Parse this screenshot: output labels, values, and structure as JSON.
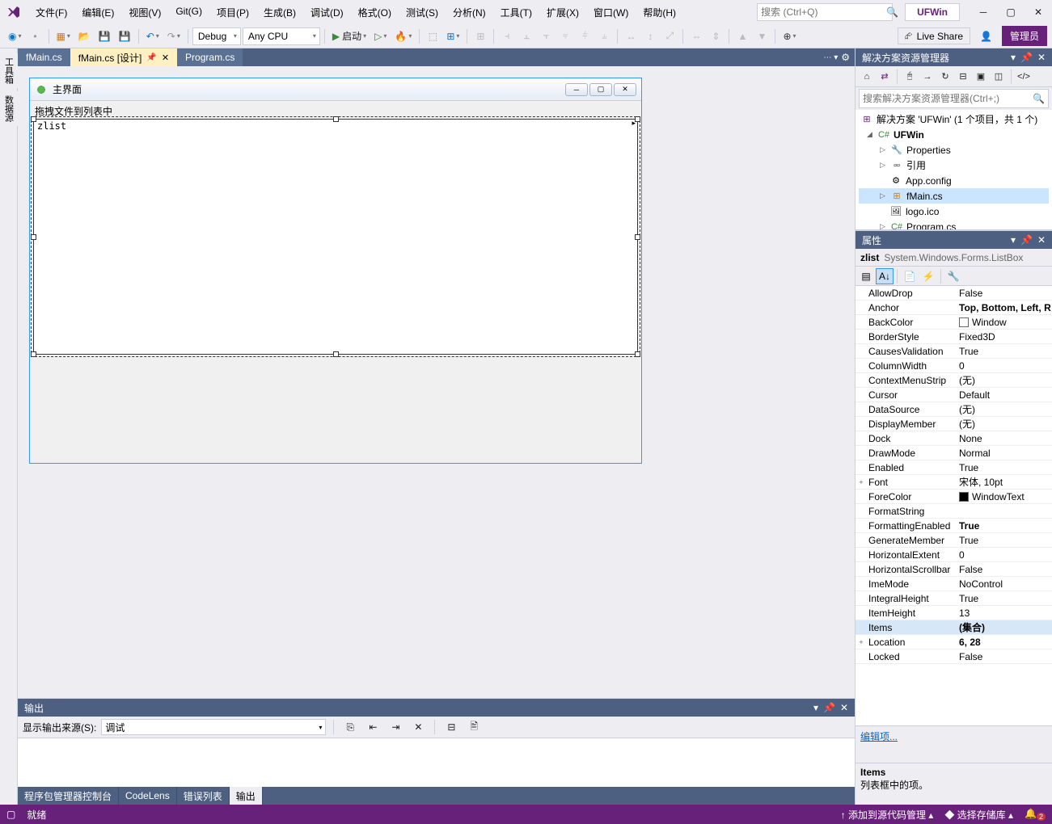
{
  "title": {
    "project": "UFWin"
  },
  "menu": [
    "文件(F)",
    "编辑(E)",
    "视图(V)",
    "Git(G)",
    "项目(P)",
    "生成(B)",
    "调试(D)",
    "格式(O)",
    "测试(S)",
    "分析(N)",
    "工具(T)",
    "扩展(X)",
    "窗口(W)",
    "帮助(H)"
  ],
  "search": {
    "placeholder": "搜索 (Ctrl+Q)"
  },
  "toolbar": {
    "config": "Debug",
    "platform": "Any CPU",
    "start": "启动",
    "liveshare": "Live Share",
    "admin": "管理员"
  },
  "leftRail": [
    "工具箱",
    "数据源"
  ],
  "tabs": {
    "open": [
      "fMain.cs",
      "fMain.cs [设计]",
      "Program.cs"
    ],
    "activeIndex": 1
  },
  "designerForm": {
    "title": "主界面",
    "label": "拖拽文件到列表中",
    "listboxText": "zlist"
  },
  "solutionExplorer": {
    "title": "解决方案资源管理器",
    "searchPlaceholder": "搜索解决方案资源管理器(Ctrl+;)",
    "solution": "解决方案 'UFWin' (1 个项目，共 1 个)",
    "projName": "UFWin",
    "nodes": [
      "Properties",
      "引用",
      "App.config",
      "fMain.cs",
      "logo.ico",
      "Program.cs"
    ]
  },
  "properties": {
    "title": "属性",
    "object": "zlist",
    "type": "System.Windows.Forms.ListBox",
    "rows": [
      {
        "n": "AllowDrop",
        "v": "False"
      },
      {
        "n": "Anchor",
        "v": "Top, Bottom, Left, R",
        "bold": true
      },
      {
        "n": "BackColor",
        "v": "Window",
        "color": "#ffffff"
      },
      {
        "n": "BorderStyle",
        "v": "Fixed3D"
      },
      {
        "n": "CausesValidation",
        "v": "True"
      },
      {
        "n": "ColumnWidth",
        "v": "0"
      },
      {
        "n": "ContextMenuStrip",
        "v": "(无)"
      },
      {
        "n": "Cursor",
        "v": "Default"
      },
      {
        "n": "DataSource",
        "v": "(无)"
      },
      {
        "n": "DisplayMember",
        "v": "(无)"
      },
      {
        "n": "Dock",
        "v": "None"
      },
      {
        "n": "DrawMode",
        "v": "Normal"
      },
      {
        "n": "Enabled",
        "v": "True"
      },
      {
        "n": "Font",
        "v": "宋体, 10pt",
        "exp": "+"
      },
      {
        "n": "ForeColor",
        "v": "WindowText",
        "color": "#000000"
      },
      {
        "n": "FormatString",
        "v": ""
      },
      {
        "n": "FormattingEnabled",
        "v": "True",
        "bold": true
      },
      {
        "n": "GenerateMember",
        "v": "True"
      },
      {
        "n": "HorizontalExtent",
        "v": "0"
      },
      {
        "n": "HorizontalScrollbar",
        "v": "False"
      },
      {
        "n": "ImeMode",
        "v": "NoControl"
      },
      {
        "n": "IntegralHeight",
        "v": "True"
      },
      {
        "n": "ItemHeight",
        "v": "13"
      },
      {
        "n": "Items",
        "v": "(集合)",
        "sel": true,
        "bold": true
      },
      {
        "n": "Location",
        "v": "6, 28",
        "bold": true,
        "exp": "+"
      },
      {
        "n": "Locked",
        "v": "False"
      }
    ],
    "link": "编辑项...",
    "helpTitle": "Items",
    "helpDesc": "列表框中的项。"
  },
  "output": {
    "title": "输出",
    "sourceLabel": "显示输出来源(S):",
    "source": "调试"
  },
  "bottomTabs": [
    "程序包管理器控制台",
    "CodeLens",
    "错误列表",
    "输出"
  ],
  "bottomActive": 3,
  "status": {
    "ready": "就绪",
    "addSource": "添加到源代码管理",
    "selectRepo": "选择存储库",
    "notif": "2"
  }
}
